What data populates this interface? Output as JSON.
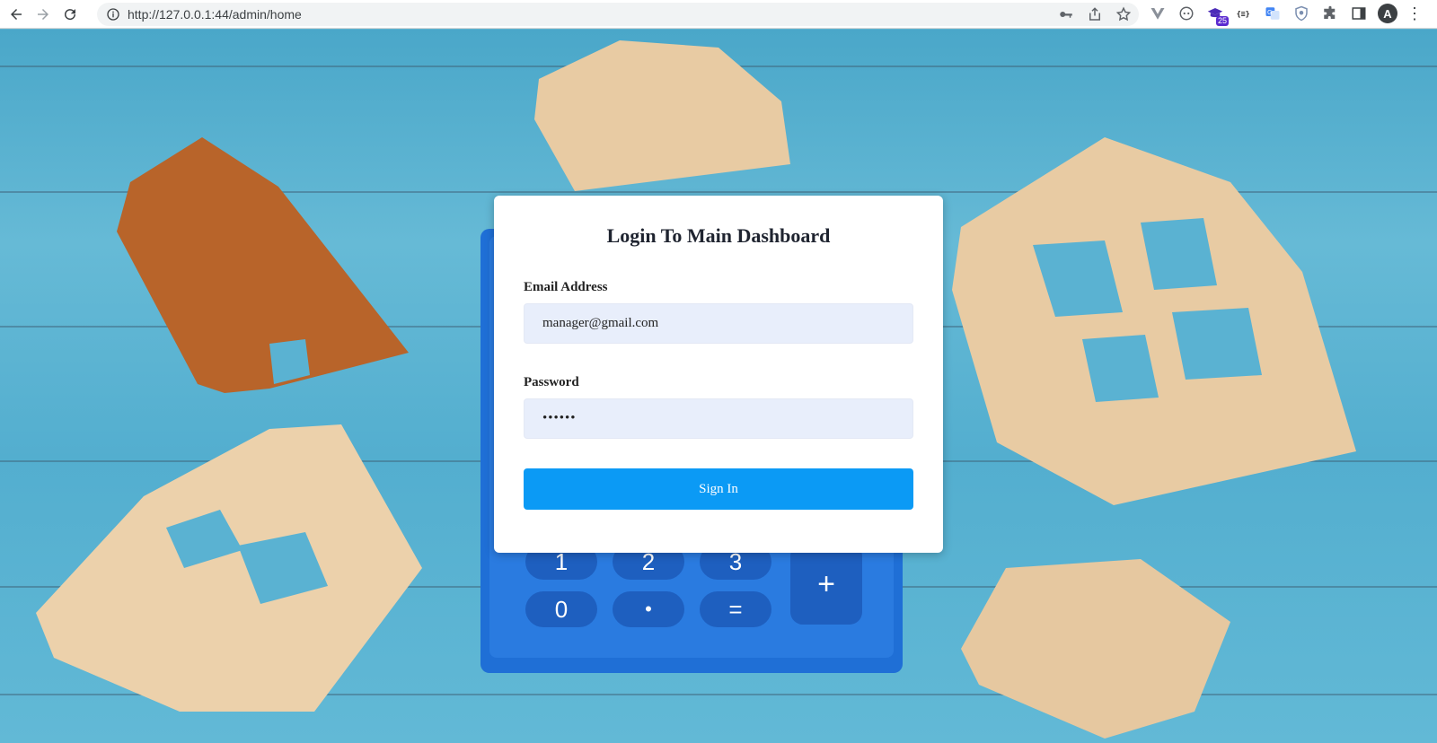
{
  "browser": {
    "url": "http://127.0.0.1:44/admin/home",
    "avatar_letter": "A",
    "extension_badge": "25",
    "icons": [
      "back-icon",
      "forward-icon",
      "reload-icon",
      "info-icon",
      "key-icon",
      "share-icon",
      "star-icon",
      "vue-devtools-icon",
      "dev-tools-icon",
      "grad-cap-icon",
      "json-icon",
      "translate-icon",
      "shield-icon",
      "puzzle-icon",
      "side-panel-icon"
    ]
  },
  "login": {
    "title": "Login To Main Dashboard",
    "email_label": "Email Address",
    "email_value": "manager@gmail.com",
    "password_label": "Password",
    "password_value": "••••••",
    "signin_label": "Sign In"
  },
  "background": {
    "description_colors": {
      "wood_dark": "#b8642a",
      "wood_light": "#e8cba3",
      "calculator": "#1f6fd6",
      "table": "#5bb4d3"
    },
    "calculator_keys": [
      "1",
      "2",
      "3",
      "+",
      "0",
      "•",
      "="
    ]
  },
  "colors": {
    "accent": "#0b9af5",
    "input_bg": "#e8eefb",
    "title": "#1f2430"
  }
}
